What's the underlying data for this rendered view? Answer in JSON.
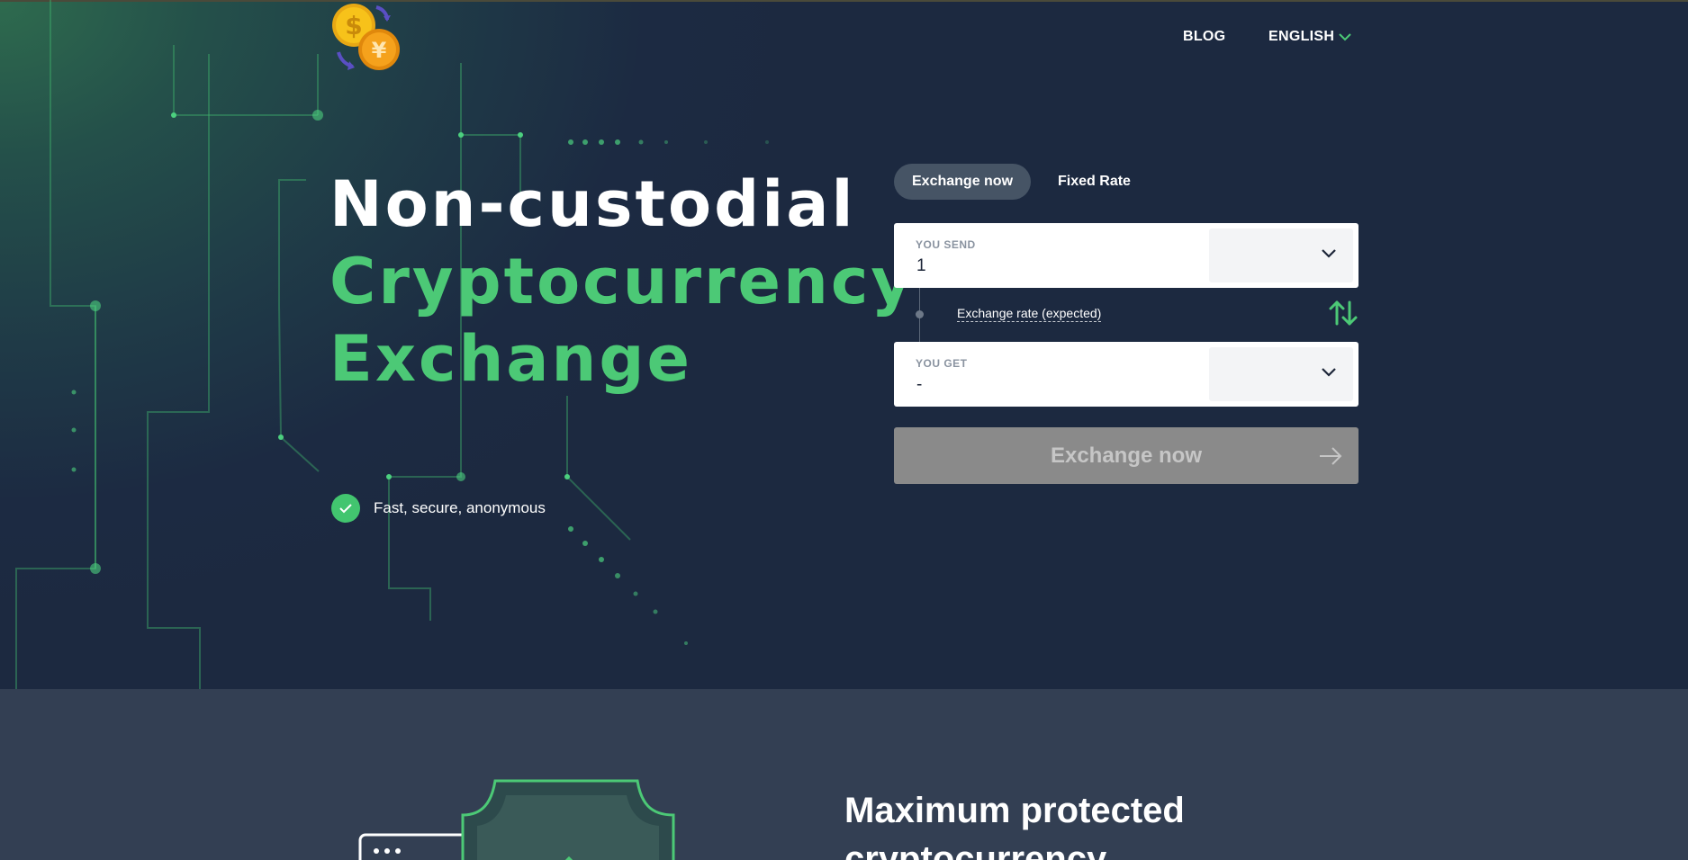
{
  "nav": {
    "blog": "BLOG",
    "language": "ENGLISH"
  },
  "hero": {
    "line1": "Non-custodial",
    "line2": "Cryptocurrency",
    "line3": "Exchange",
    "feature": "Fast, secure, anonymous"
  },
  "tabs": {
    "exchange": "Exchange now",
    "fixed": "Fixed Rate"
  },
  "send": {
    "label": "YOU SEND",
    "value": "1"
  },
  "rate": {
    "label": "Exchange rate (expected)"
  },
  "get": {
    "label": "YOU GET",
    "value": "-"
  },
  "button": {
    "label": "Exchange now"
  },
  "section2": {
    "title": "Maximum protected cryptocurrency"
  },
  "colors": {
    "accent": "#4cc976",
    "background": "#1c2940",
    "button_disabled": "#8a8a8a"
  },
  "icons": [
    "logo-coins-icon",
    "chevron-down-icon",
    "check-icon",
    "swap-arrows-icon",
    "arrow-right-icon",
    "shield-icon"
  ]
}
